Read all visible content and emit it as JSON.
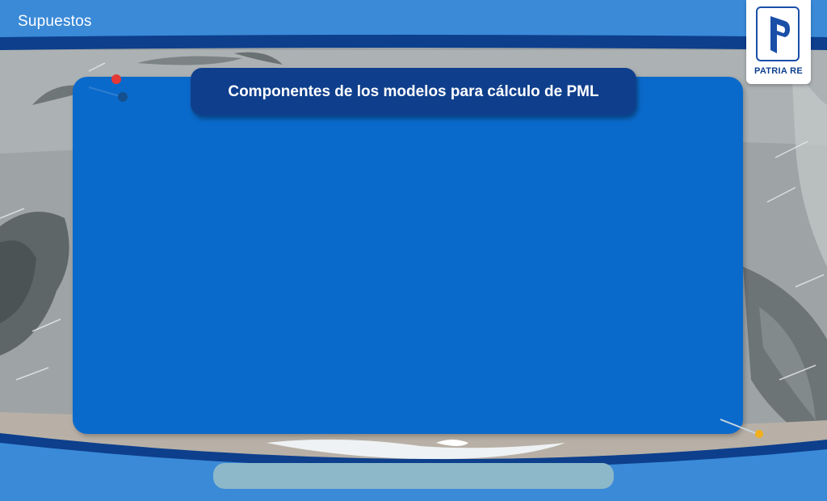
{
  "header": {
    "title": "Supuestos"
  },
  "logo": {
    "text": "PATRIA RE",
    "icon": "patria-re-logo"
  },
  "banner": {
    "title": "Componentes de los modelos para cálculo de PML"
  },
  "colors": {
    "background": "#3a8ad8",
    "panel": "#0a6acb",
    "banner": "#0f3f8c",
    "frame_band": "#0d3f8c",
    "bottom_bar": "#8cb8c9",
    "pin_red": "#e53935",
    "pin_yellow": "#f2b01e"
  },
  "decorations": {
    "background_illustration": "storm-scene-illustration",
    "pins": [
      "red-pin-icon",
      "yellow-pin-icon"
    ]
  }
}
